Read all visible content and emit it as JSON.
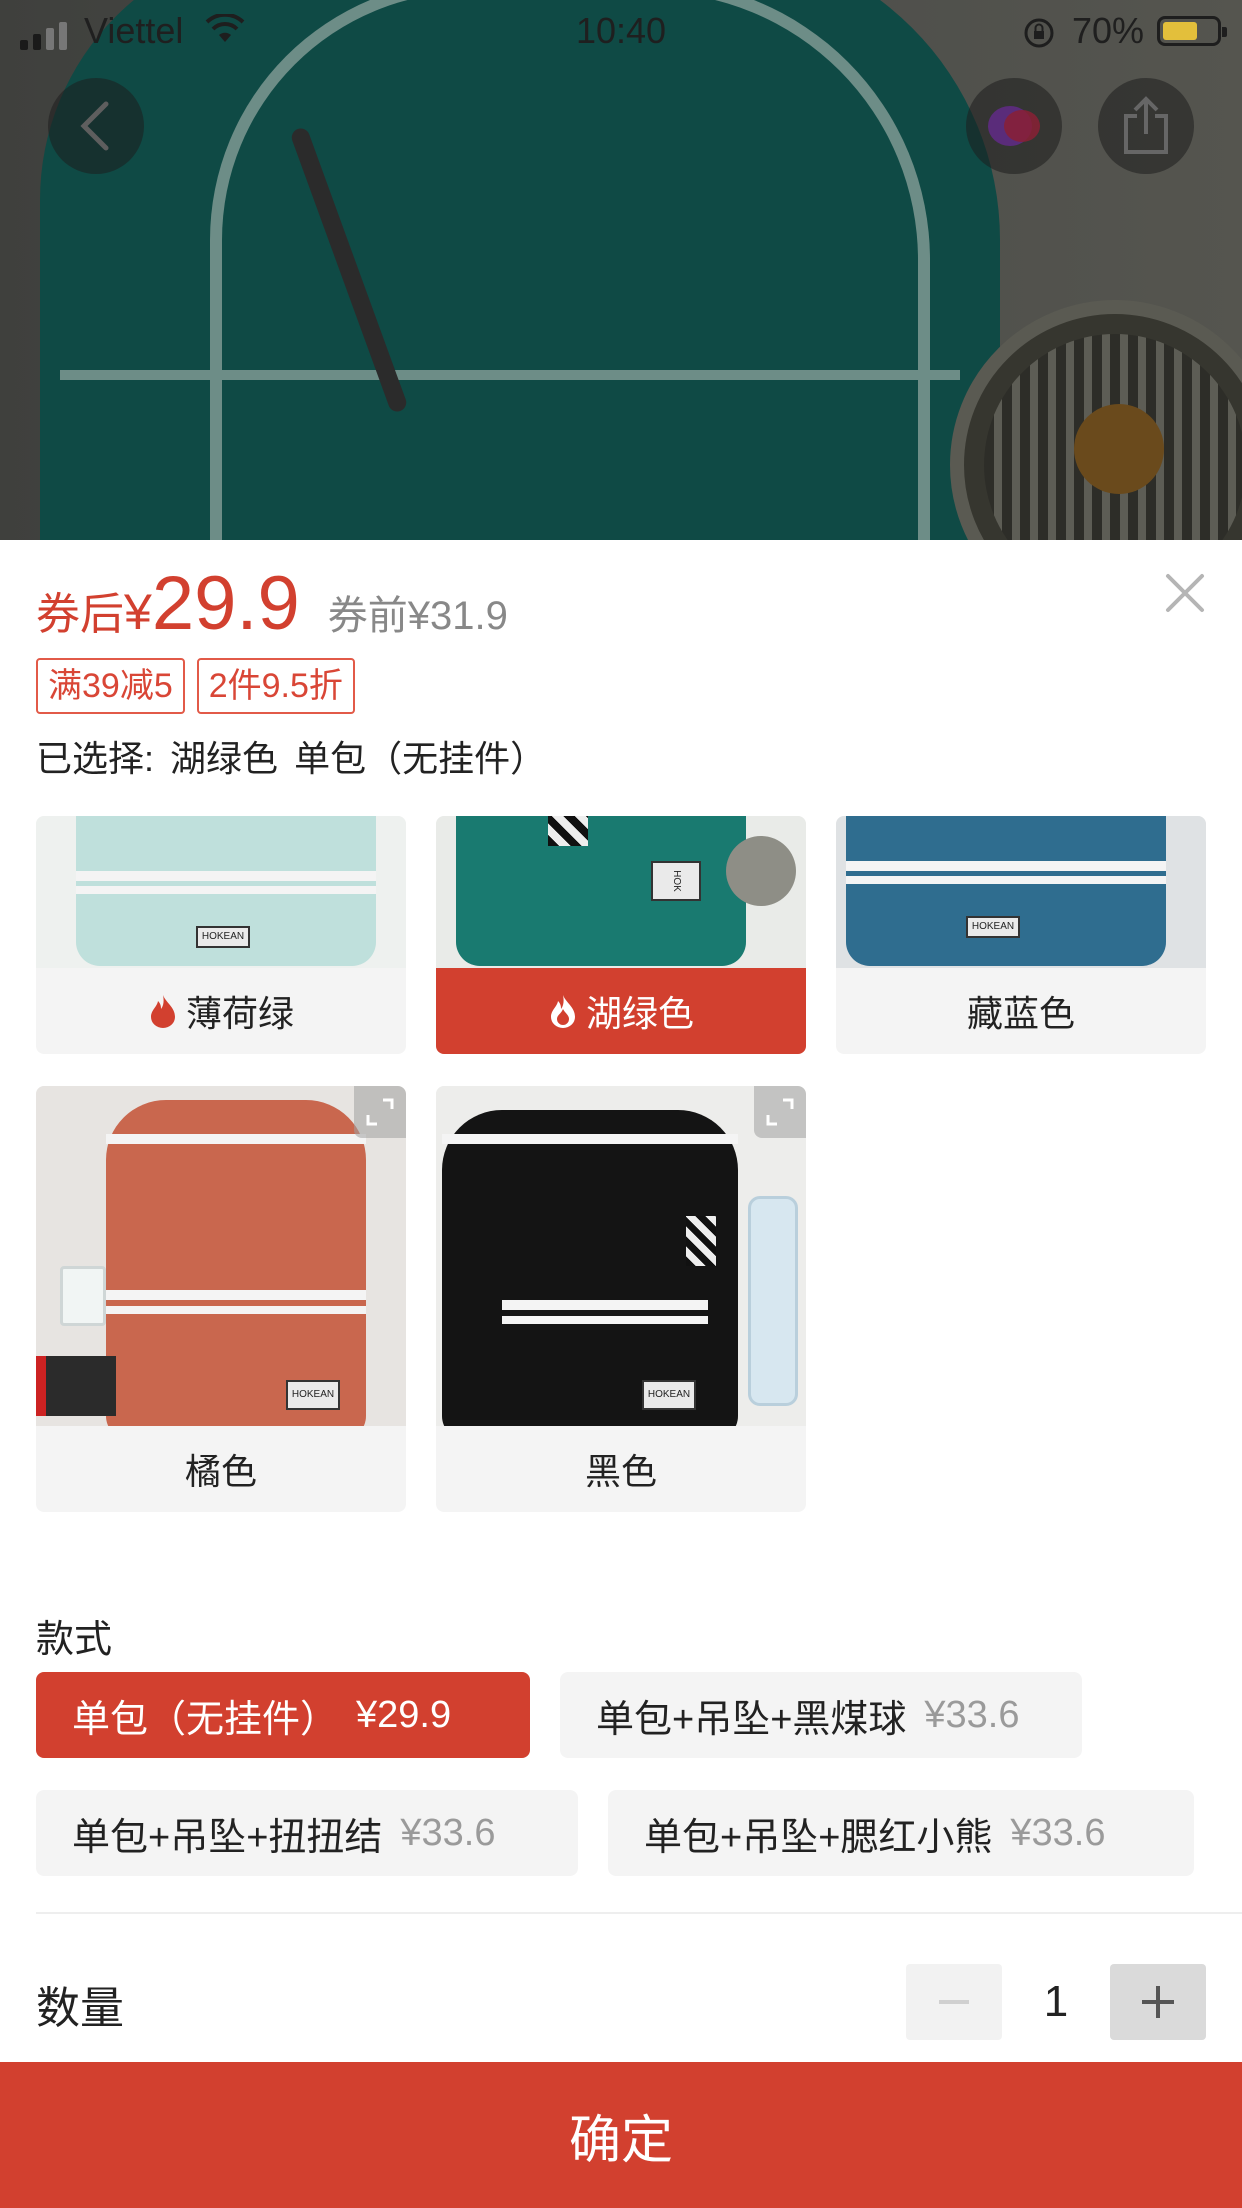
{
  "status_bar": {
    "carrier": "Viettel",
    "time": "10:40",
    "battery_percent": "70%"
  },
  "nav": {
    "back_icon": "chevron-left-icon",
    "live_icon": "live-orb-icon",
    "share_icon": "share-icon"
  },
  "price": {
    "after_label": "券后",
    "currency": "¥",
    "after_value": "29.9",
    "before_text": "券前¥31.9"
  },
  "promo_tags": [
    "满39减5",
    "2件9.5折"
  ],
  "selected": {
    "prefix": "已选择:",
    "color": "湖绿色",
    "style": "单包（无挂件）"
  },
  "colors": [
    {
      "name": "薄荷绿",
      "hot": true,
      "selected": false
    },
    {
      "name": "湖绿色",
      "hot": true,
      "selected": true
    },
    {
      "name": "藏蓝色",
      "hot": false,
      "selected": false
    },
    {
      "name": "橘色",
      "hot": false,
      "selected": false
    },
    {
      "name": "黑色",
      "hot": false,
      "selected": false
    }
  ],
  "style_section": {
    "title": "款式",
    "options": [
      {
        "name": "单包（无挂件）",
        "price": "¥29.9",
        "selected": true
      },
      {
        "name": "单包+吊坠+黑煤球",
        "price": "¥33.6",
        "selected": false
      },
      {
        "name": "单包+吊坠+扭扭结",
        "price": "¥33.6",
        "selected": false
      },
      {
        "name": "单包+吊坠+腮红小熊",
        "price": "¥33.6",
        "selected": false
      }
    ]
  },
  "quantity": {
    "label": "数量",
    "value": "1"
  },
  "confirm_label": "确定",
  "colors_palette": {
    "accent": "#d2402f",
    "chip_bg": "#f4f4f4",
    "muted_price": "#9a9a9a"
  }
}
